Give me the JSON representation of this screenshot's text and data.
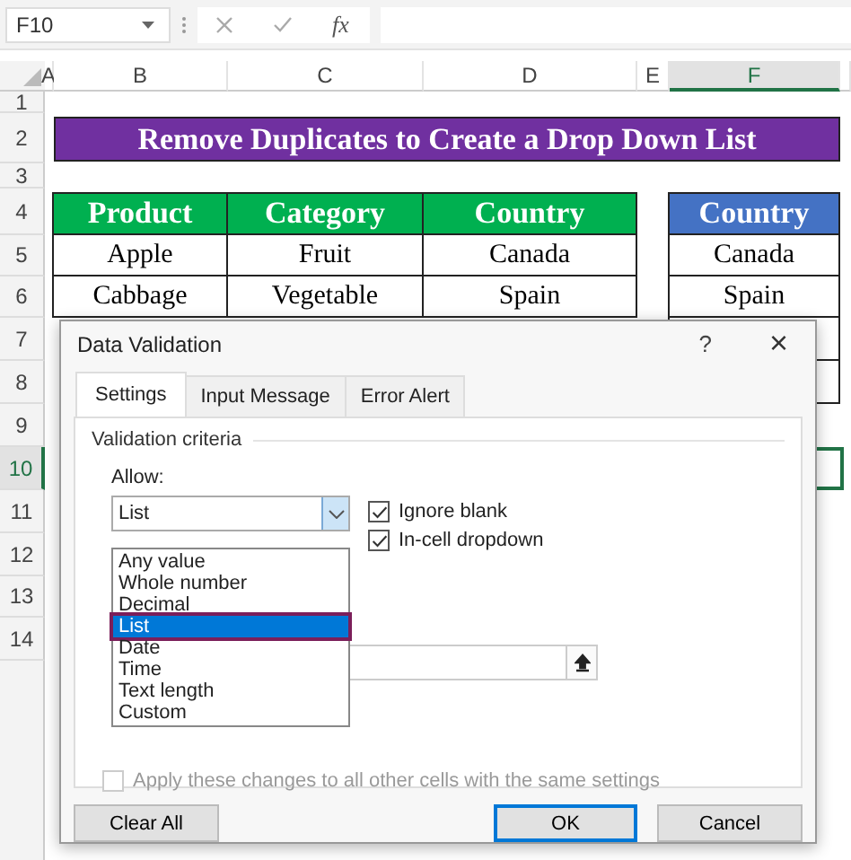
{
  "name_box": {
    "value": "F10"
  },
  "formula_bar": {
    "function_label": "fx"
  },
  "columns": [
    {
      "label": "A",
      "selected": false
    },
    {
      "label": "B",
      "selected": false
    },
    {
      "label": "C",
      "selected": false
    },
    {
      "label": "D",
      "selected": false
    },
    {
      "label": "E",
      "selected": false
    },
    {
      "label": "F",
      "selected": true
    }
  ],
  "rows": [
    {
      "label": "1",
      "selected": false
    },
    {
      "label": "2",
      "selected": false
    },
    {
      "label": "3",
      "selected": false
    },
    {
      "label": "4",
      "selected": false
    },
    {
      "label": "5",
      "selected": false
    },
    {
      "label": "6",
      "selected": false
    },
    {
      "label": "7",
      "selected": false
    },
    {
      "label": "8",
      "selected": false
    },
    {
      "label": "9",
      "selected": false
    },
    {
      "label": "10",
      "selected": true
    },
    {
      "label": "11",
      "selected": false
    },
    {
      "label": "12",
      "selected": false
    },
    {
      "label": "13",
      "selected": false
    },
    {
      "label": "14",
      "selected": false
    }
  ],
  "title": "Remove Duplicates to Create a Drop Down List",
  "table": {
    "columns": [
      "Product",
      "Category",
      "Country"
    ],
    "rows": [
      [
        "Apple",
        "Fruit",
        "Canada"
      ],
      [
        "Cabbage",
        "Vegetable",
        "Spain"
      ]
    ]
  },
  "unique_table": {
    "column": "Country",
    "rows": [
      "Canada",
      "Spain"
    ]
  },
  "dialog": {
    "title": "Data Validation",
    "help": "?",
    "close": "×",
    "tabs": [
      {
        "label": "Settings",
        "selected": true
      },
      {
        "label": "Input Message",
        "selected": false
      },
      {
        "label": "Error Alert",
        "selected": false
      }
    ],
    "group_label": "Validation criteria",
    "allow_label": "Allow:",
    "allow_value": "List",
    "options": [
      {
        "label": "Any value",
        "selected": false
      },
      {
        "label": "Whole number",
        "selected": false
      },
      {
        "label": "Decimal",
        "selected": false
      },
      {
        "label": "List",
        "selected": true
      },
      {
        "label": "Date",
        "selected": false
      },
      {
        "label": "Time",
        "selected": false
      },
      {
        "label": "Text length",
        "selected": false
      },
      {
        "label": "Custom",
        "selected": false
      }
    ],
    "checkboxes": [
      {
        "label": "Ignore blank",
        "checked": true
      },
      {
        "label": "In-cell dropdown",
        "checked": true
      }
    ],
    "apply": {
      "label": "Apply these changes to all other cells with the same settings",
      "checked": false,
      "disabled": true
    },
    "buttons": [
      {
        "label": "Clear All",
        "kind": "normal"
      },
      {
        "label": "OK",
        "kind": "default"
      },
      {
        "label": "Cancel",
        "kind": "normal"
      }
    ]
  }
}
